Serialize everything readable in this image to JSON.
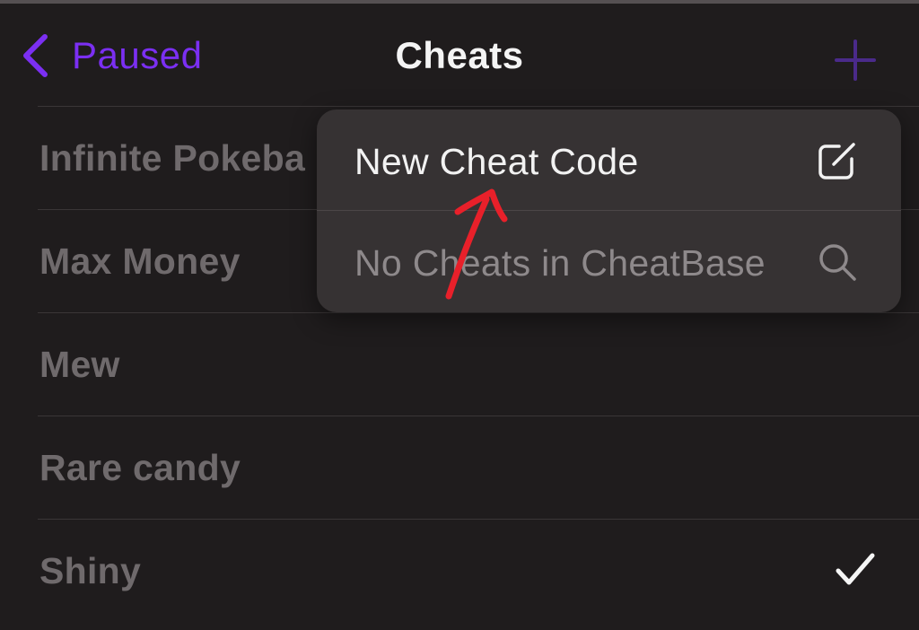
{
  "nav": {
    "back_label": "Paused",
    "title": "Cheats",
    "accent_color": "#7b2ff2"
  },
  "cheats": [
    {
      "label": "Infinite Pokeba",
      "checked": false
    },
    {
      "label": "Max Money",
      "checked": false
    },
    {
      "label": "Mew",
      "checked": false
    },
    {
      "label": "Rare candy",
      "checked": false
    },
    {
      "label": "Shiny",
      "checked": true
    }
  ],
  "menu": {
    "items": [
      {
        "label": "New Cheat Code",
        "icon": "compose-icon"
      },
      {
        "label": "No Cheats in CheatBase",
        "icon": "search-icon"
      }
    ]
  },
  "annotation": {
    "arrow_color": "#e8202a"
  }
}
